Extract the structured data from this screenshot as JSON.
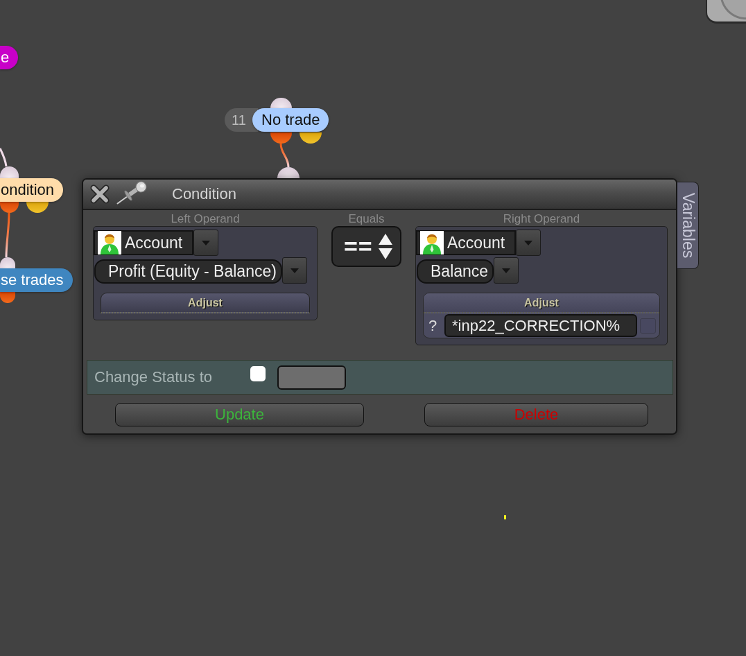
{
  "canvas": {
    "nodes": [
      {
        "label": "e",
        "color": "#c800c8"
      },
      {
        "badge": "11",
        "label": "No trade",
        "color": "#a8ccff"
      },
      {
        "label": "ondition",
        "color": "#ffdcaa"
      },
      {
        "label": "se trades",
        "color": "#3f86c0"
      }
    ]
  },
  "dialog": {
    "title": "Condition",
    "left_operand": {
      "label": "Left Operand",
      "source": "Account",
      "field": "Profit (Equity - Balance)",
      "adjust": {
        "label": "Adjust",
        "expanded": false
      }
    },
    "operator": {
      "label": "Equals",
      "value": "=="
    },
    "right_operand": {
      "label": "Right Operand",
      "source": "Account",
      "field": "Balance",
      "adjust": {
        "label": "Adjust",
        "expanded": true,
        "prefix": "?",
        "value": "*inp22_CORRECTION%",
        "checked": false
      }
    },
    "status": {
      "label": "Change Status to",
      "checked": false
    },
    "buttons": [
      {
        "label": "Update",
        "kind": "update"
      },
      {
        "label": "Delete",
        "kind": "delete"
      }
    ],
    "side_tab": "Variables"
  }
}
